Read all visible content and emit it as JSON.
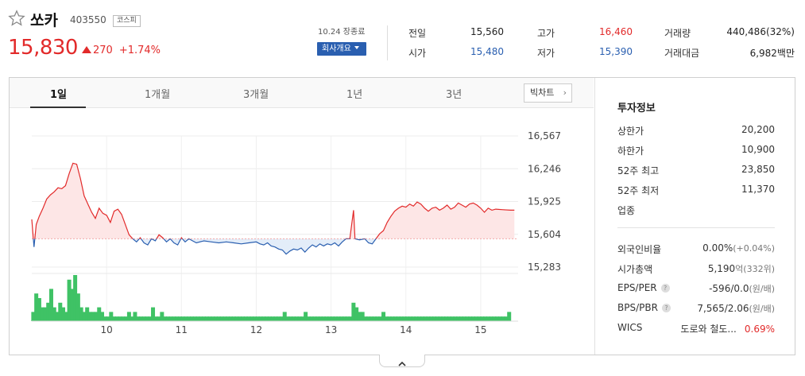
{
  "stock": {
    "name": "쏘카",
    "code": "403550",
    "market": "코스피",
    "price": "15,830",
    "change": "270",
    "change_pct": "+1.74%",
    "date": "10.24 장종료",
    "company_button": "회사개요"
  },
  "stats": [
    {
      "label": "전일",
      "value": "15,560",
      "color": "#333333"
    },
    {
      "label": "시가",
      "value": "15,480",
      "color": "#2a5fb0"
    },
    {
      "label": "고가",
      "value": "16,460",
      "color": "#e22a2a"
    },
    {
      "label": "저가",
      "value": "15,390",
      "color": "#2a5fb0"
    },
    {
      "label": "거래량",
      "value": "440,486(32%)",
      "color": "#333333"
    },
    {
      "label": "거래대금",
      "value": "6,982백만",
      "color": "#333333"
    }
  ],
  "tabs": [
    "1일",
    "1개월",
    "3개월",
    "1년",
    "3년"
  ],
  "active_tab": "1일",
  "bigchart_label": "빅차트",
  "invest": {
    "title": "투자정보",
    "rows": [
      {
        "label": "상한가",
        "value": "20,200",
        "color": "#e22a2a"
      },
      {
        "label": "하한가",
        "value": "10,900",
        "color": "#2a5fb0"
      },
      {
        "label": "52주 최고",
        "value": "23,850",
        "color": "#333333"
      },
      {
        "label": "52주 최저",
        "value": "11,370",
        "color": "#333333"
      },
      {
        "label": "업종",
        "value": "",
        "color": "#333333"
      }
    ],
    "rows2": [
      {
        "label": "외국인비율",
        "value": "0.00%",
        "sub": "(+0.04%)"
      },
      {
        "label": "시가총액",
        "value": "5,190",
        "sub": "억(332위)"
      },
      {
        "label": "EPS/PER",
        "value": "-596/0.0",
        "sub": "(원/배)",
        "help": "?"
      },
      {
        "label": "BPS/PBR",
        "value": "7,565/2.06",
        "sub": "(원/배)",
        "help": "?"
      },
      {
        "label": "WICS",
        "value": "도로와 철도...",
        "sub": "",
        "extra": "0.69%"
      }
    ]
  },
  "colors": {
    "up": "#e22a2a",
    "down": "#2a5fb0",
    "volume": "#3fc265"
  },
  "chart_data": {
    "type": "line",
    "baseline": 15560,
    "y_ticks": [
      16567,
      16246,
      15925,
      15604,
      15283
    ],
    "ylim": [
      15283,
      16567
    ],
    "x_ticks": [
      "10",
      "11",
      "12",
      "13",
      "14",
      "15"
    ],
    "x_range": [
      9,
      15.5
    ],
    "price": [
      [
        9.0,
        15750
      ],
      [
        9.03,
        15480
      ],
      [
        9.06,
        15700
      ],
      [
        9.1,
        15780
      ],
      [
        9.15,
        15860
      ],
      [
        9.2,
        15950
      ],
      [
        9.25,
        15990
      ],
      [
        9.3,
        16020
      ],
      [
        9.35,
        16060
      ],
      [
        9.4,
        16050
      ],
      [
        9.45,
        16080
      ],
      [
        9.5,
        16200
      ],
      [
        9.55,
        16300
      ],
      [
        9.6,
        16290
      ],
      [
        9.65,
        16150
      ],
      [
        9.7,
        15980
      ],
      [
        9.75,
        15900
      ],
      [
        9.8,
        15820
      ],
      [
        9.85,
        15760
      ],
      [
        9.9,
        15860
      ],
      [
        9.95,
        15810
      ],
      [
        10.0,
        15790
      ],
      [
        10.05,
        15720
      ],
      [
        10.1,
        15830
      ],
      [
        10.15,
        15850
      ],
      [
        10.2,
        15800
      ],
      [
        10.25,
        15700
      ],
      [
        10.3,
        15600
      ],
      [
        10.35,
        15560
      ],
      [
        10.4,
        15530
      ],
      [
        10.45,
        15570
      ],
      [
        10.5,
        15520
      ],
      [
        10.55,
        15500
      ],
      [
        10.6,
        15560
      ],
      [
        10.65,
        15540
      ],
      [
        10.7,
        15600
      ],
      [
        10.75,
        15570
      ],
      [
        10.8,
        15530
      ],
      [
        10.85,
        15560
      ],
      [
        10.9,
        15520
      ],
      [
        10.95,
        15500
      ],
      [
        11.0,
        15570
      ],
      [
        11.05,
        15530
      ],
      [
        11.1,
        15560
      ],
      [
        11.15,
        15540
      ],
      [
        11.2,
        15520
      ],
      [
        11.3,
        15540
      ],
      [
        11.4,
        15530
      ],
      [
        11.5,
        15520
      ],
      [
        11.6,
        15530
      ],
      [
        11.7,
        15520
      ],
      [
        11.8,
        15510
      ],
      [
        11.9,
        15520
      ],
      [
        12.0,
        15530
      ],
      [
        12.05,
        15510
      ],
      [
        12.1,
        15500
      ],
      [
        12.15,
        15520
      ],
      [
        12.2,
        15490
      ],
      [
        12.25,
        15480
      ],
      [
        12.3,
        15460
      ],
      [
        12.35,
        15450
      ],
      [
        12.4,
        15410
      ],
      [
        12.45,
        15440
      ],
      [
        12.5,
        15460
      ],
      [
        12.55,
        15450
      ],
      [
        12.6,
        15470
      ],
      [
        12.65,
        15430
      ],
      [
        12.7,
        15470
      ],
      [
        12.75,
        15500
      ],
      [
        12.8,
        15480
      ],
      [
        12.85,
        15510
      ],
      [
        12.9,
        15490
      ],
      [
        12.95,
        15510
      ],
      [
        13.0,
        15500
      ],
      [
        13.05,
        15520
      ],
      [
        13.1,
        15490
      ],
      [
        13.15,
        15530
      ],
      [
        13.2,
        15560
      ],
      [
        13.25,
        15560
      ],
      [
        13.3,
        15840
      ],
      [
        13.32,
        15560
      ],
      [
        13.38,
        15550
      ],
      [
        13.45,
        15560
      ],
      [
        13.5,
        15520
      ],
      [
        13.55,
        15510
      ],
      [
        13.6,
        15560
      ],
      [
        13.65,
        15610
      ],
      [
        13.7,
        15640
      ],
      [
        13.75,
        15720
      ],
      [
        13.8,
        15780
      ],
      [
        13.85,
        15830
      ],
      [
        13.9,
        15860
      ],
      [
        13.95,
        15880
      ],
      [
        14.0,
        15870
      ],
      [
        14.05,
        15900
      ],
      [
        14.1,
        15880
      ],
      [
        14.15,
        15920
      ],
      [
        14.2,
        15900
      ],
      [
        14.25,
        15860
      ],
      [
        14.3,
        15830
      ],
      [
        14.35,
        15860
      ],
      [
        14.4,
        15870
      ],
      [
        14.45,
        15840
      ],
      [
        14.5,
        15860
      ],
      [
        14.55,
        15890
      ],
      [
        14.6,
        15850
      ],
      [
        14.65,
        15870
      ],
      [
        14.7,
        15910
      ],
      [
        14.75,
        15890
      ],
      [
        14.8,
        15870
      ],
      [
        14.85,
        15900
      ],
      [
        14.9,
        15910
      ],
      [
        14.95,
        15890
      ],
      [
        15.0,
        15860
      ],
      [
        15.05,
        15820
      ],
      [
        15.1,
        15860
      ],
      [
        15.15,
        15840
      ],
      [
        15.2,
        15850
      ],
      [
        15.3,
        15845
      ],
      [
        15.4,
        15840
      ],
      [
        15.45,
        15840
      ]
    ],
    "volume": [
      [
        9.02,
        2
      ],
      [
        9.06,
        6
      ],
      [
        9.1,
        5
      ],
      [
        9.14,
        3
      ],
      [
        9.18,
        3
      ],
      [
        9.22,
        4
      ],
      [
        9.26,
        7
      ],
      [
        9.3,
        3
      ],
      [
        9.34,
        2
      ],
      [
        9.38,
        4
      ],
      [
        9.42,
        3
      ],
      [
        9.46,
        2
      ],
      [
        9.5,
        9
      ],
      [
        9.54,
        7
      ],
      [
        9.58,
        10
      ],
      [
        9.62,
        6
      ],
      [
        9.66,
        3
      ],
      [
        9.7,
        2
      ],
      [
        9.74,
        3
      ],
      [
        9.78,
        2
      ],
      [
        9.82,
        2
      ],
      [
        9.86,
        2
      ],
      [
        9.9,
        3
      ],
      [
        9.94,
        2
      ],
      [
        9.98,
        1
      ],
      [
        10.02,
        1
      ],
      [
        10.06,
        2
      ],
      [
        10.1,
        1
      ],
      [
        10.14,
        1
      ],
      [
        10.18,
        1
      ],
      [
        10.22,
        1
      ],
      [
        10.26,
        1
      ],
      [
        10.3,
        2
      ],
      [
        10.34,
        1
      ],
      [
        10.38,
        2
      ],
      [
        10.42,
        1
      ],
      [
        10.46,
        1
      ],
      [
        10.5,
        1
      ],
      [
        10.54,
        1
      ],
      [
        10.58,
        1
      ],
      [
        10.62,
        3
      ],
      [
        10.66,
        1
      ],
      [
        10.7,
        1
      ],
      [
        10.74,
        2
      ],
      [
        10.78,
        1
      ],
      [
        10.82,
        1
      ],
      [
        10.86,
        1
      ],
      [
        10.9,
        1
      ],
      [
        10.94,
        1
      ],
      [
        10.98,
        1
      ],
      [
        11.02,
        1
      ],
      [
        11.06,
        1
      ],
      [
        11.1,
        1
      ],
      [
        11.14,
        1
      ],
      [
        11.18,
        1
      ],
      [
        11.22,
        1
      ],
      [
        11.26,
        1
      ],
      [
        11.3,
        1
      ],
      [
        11.34,
        1
      ],
      [
        11.38,
        1
      ],
      [
        11.42,
        1
      ],
      [
        11.46,
        1
      ],
      [
        11.5,
        1
      ],
      [
        11.54,
        1
      ],
      [
        11.58,
        1
      ],
      [
        11.62,
        1
      ],
      [
        11.66,
        1
      ],
      [
        11.7,
        1
      ],
      [
        11.74,
        1
      ],
      [
        11.78,
        1
      ],
      [
        11.82,
        1
      ],
      [
        11.86,
        1
      ],
      [
        11.9,
        1
      ],
      [
        11.94,
        1
      ],
      [
        11.98,
        1
      ],
      [
        12.02,
        1
      ],
      [
        12.06,
        1
      ],
      [
        12.1,
        1
      ],
      [
        12.14,
        1
      ],
      [
        12.18,
        1
      ],
      [
        12.22,
        1
      ],
      [
        12.26,
        1
      ],
      [
        12.3,
        1
      ],
      [
        12.34,
        1
      ],
      [
        12.38,
        2
      ],
      [
        12.42,
        1
      ],
      [
        12.46,
        1
      ],
      [
        12.5,
        1
      ],
      [
        12.54,
        1
      ],
      [
        12.58,
        1
      ],
      [
        12.62,
        1
      ],
      [
        12.66,
        2
      ],
      [
        12.7,
        1
      ],
      [
        12.74,
        1
      ],
      [
        12.78,
        1
      ],
      [
        12.82,
        1
      ],
      [
        12.86,
        1
      ],
      [
        12.9,
        1
      ],
      [
        12.94,
        1
      ],
      [
        12.98,
        1
      ],
      [
        13.02,
        1
      ],
      [
        13.06,
        1
      ],
      [
        13.1,
        1
      ],
      [
        13.14,
        1
      ],
      [
        13.18,
        1
      ],
      [
        13.22,
        1
      ],
      [
        13.26,
        1
      ],
      [
        13.3,
        4
      ],
      [
        13.34,
        3
      ],
      [
        13.38,
        2
      ],
      [
        13.42,
        2
      ],
      [
        13.46,
        1
      ],
      [
        13.5,
        1
      ],
      [
        13.54,
        1
      ],
      [
        13.58,
        1
      ],
      [
        13.62,
        1
      ],
      [
        13.66,
        1
      ],
      [
        13.7,
        2
      ],
      [
        13.74,
        1
      ],
      [
        13.78,
        1
      ],
      [
        13.82,
        1
      ],
      [
        13.86,
        1
      ],
      [
        13.9,
        1
      ],
      [
        13.94,
        1
      ],
      [
        13.98,
        1
      ],
      [
        14.02,
        1
      ],
      [
        14.06,
        1
      ],
      [
        14.1,
        1
      ],
      [
        14.14,
        1
      ],
      [
        14.18,
        1
      ],
      [
        14.22,
        1
      ],
      [
        14.26,
        1
      ],
      [
        14.3,
        1
      ],
      [
        14.34,
        1
      ],
      [
        14.38,
        1
      ],
      [
        14.42,
        1
      ],
      [
        14.46,
        1
      ],
      [
        14.5,
        1
      ],
      [
        14.54,
        1
      ],
      [
        14.58,
        1
      ],
      [
        14.62,
        1
      ],
      [
        14.66,
        1
      ],
      [
        14.7,
        1
      ],
      [
        14.74,
        1
      ],
      [
        14.78,
        1
      ],
      [
        14.82,
        1
      ],
      [
        14.86,
        1
      ],
      [
        14.9,
        1
      ],
      [
        14.94,
        1
      ],
      [
        14.98,
        1
      ],
      [
        15.02,
        1
      ],
      [
        15.06,
        1
      ],
      [
        15.1,
        1
      ],
      [
        15.14,
        1
      ],
      [
        15.18,
        1
      ],
      [
        15.22,
        1
      ],
      [
        15.26,
        1
      ],
      [
        15.3,
        1
      ],
      [
        15.34,
        1
      ],
      [
        15.38,
        2
      ]
    ]
  }
}
